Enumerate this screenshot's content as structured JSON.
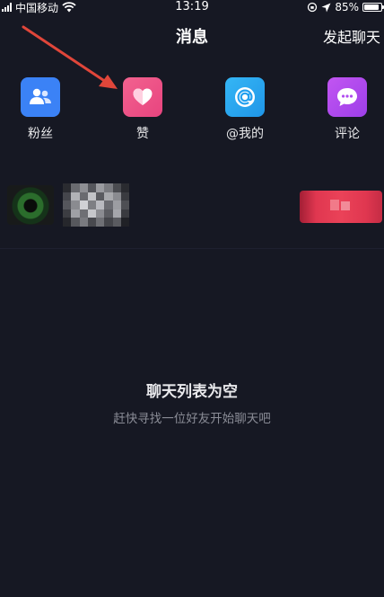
{
  "status_bar": {
    "carrier": "中国移动",
    "time": "13:19",
    "battery": "85%",
    "battery_level": 0.85
  },
  "header": {
    "title": "消息",
    "action_label": "发起聊天"
  },
  "quick_actions": [
    {
      "label": "粉丝",
      "icon": "fans-icon",
      "color": "#3b82f6"
    },
    {
      "label": "赞",
      "icon": "heart-icon",
      "color": "#ee4d8a"
    },
    {
      "label": "@我的",
      "icon": "at-icon",
      "color": "#28a6f0"
    },
    {
      "label": "评论",
      "icon": "comment-icon",
      "color": "#b44ef0"
    }
  ],
  "empty_state": {
    "title": "聊天列表为空",
    "subtitle": "赶快寻找一位好友开始聊天吧"
  },
  "colors": {
    "background": "#161823",
    "annotation_arrow": "#e0463a"
  }
}
